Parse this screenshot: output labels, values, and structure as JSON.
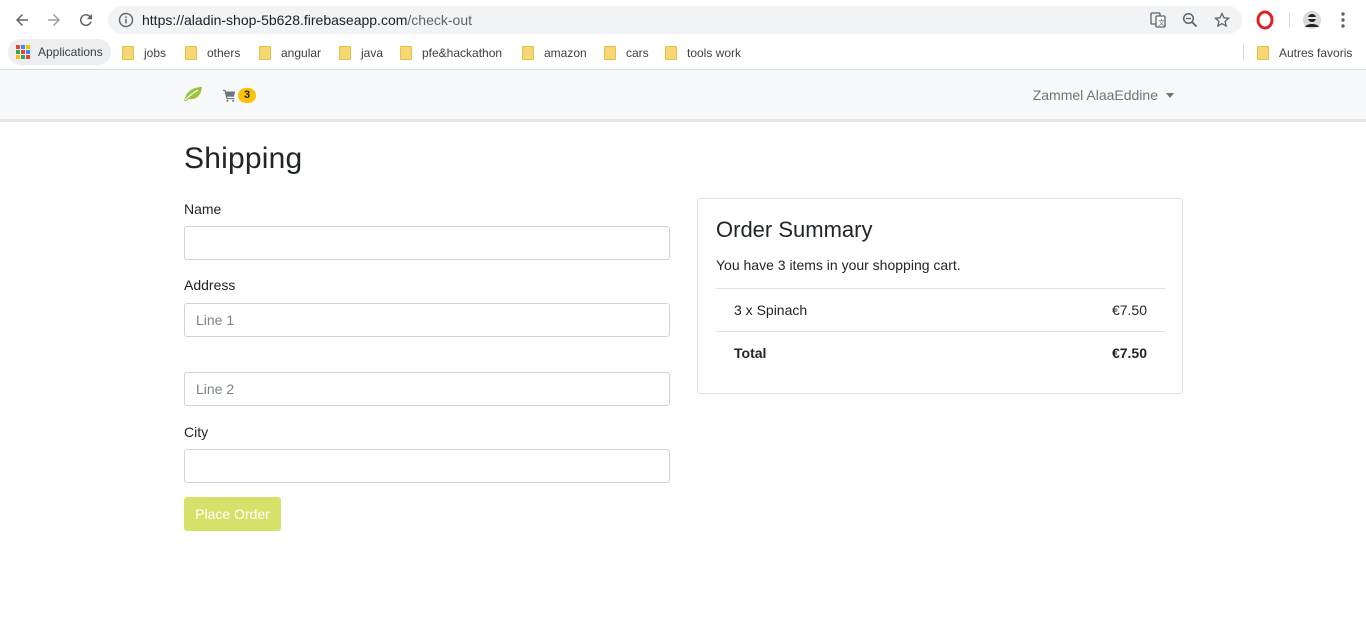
{
  "browser": {
    "url_main": "https://aladin-shop-5b628.firebaseapp.com",
    "url_path": "/check-out",
    "bookmarks": {
      "apps_label": "Applications",
      "items": [
        "jobs",
        "others",
        "angular",
        "java",
        "pfe&hackathon",
        "amazon",
        "cars",
        "tools work"
      ],
      "other_label": "Autres favoris"
    }
  },
  "navbar": {
    "cart_count": "3",
    "user_name": "Zammel AlaaEddine"
  },
  "shipping": {
    "title": "Shipping",
    "name_label": "Name",
    "name_value": "",
    "address_label": "Address",
    "line1_placeholder": "Line 1",
    "line2_placeholder": "Line 2",
    "city_label": "City",
    "city_value": "",
    "place_order_label": "Place Order"
  },
  "summary": {
    "title": "Order Summary",
    "subtitle": "You have 3 items in your shopping cart.",
    "items": [
      {
        "label": "3 x Spinach",
        "price": "€7.50"
      }
    ],
    "total_label": "Total",
    "total_value": "€7.50"
  },
  "colors": {
    "accent_button": "#d4e26a",
    "badge": "#ffc107",
    "logo_leaf": "#9bc53d"
  }
}
